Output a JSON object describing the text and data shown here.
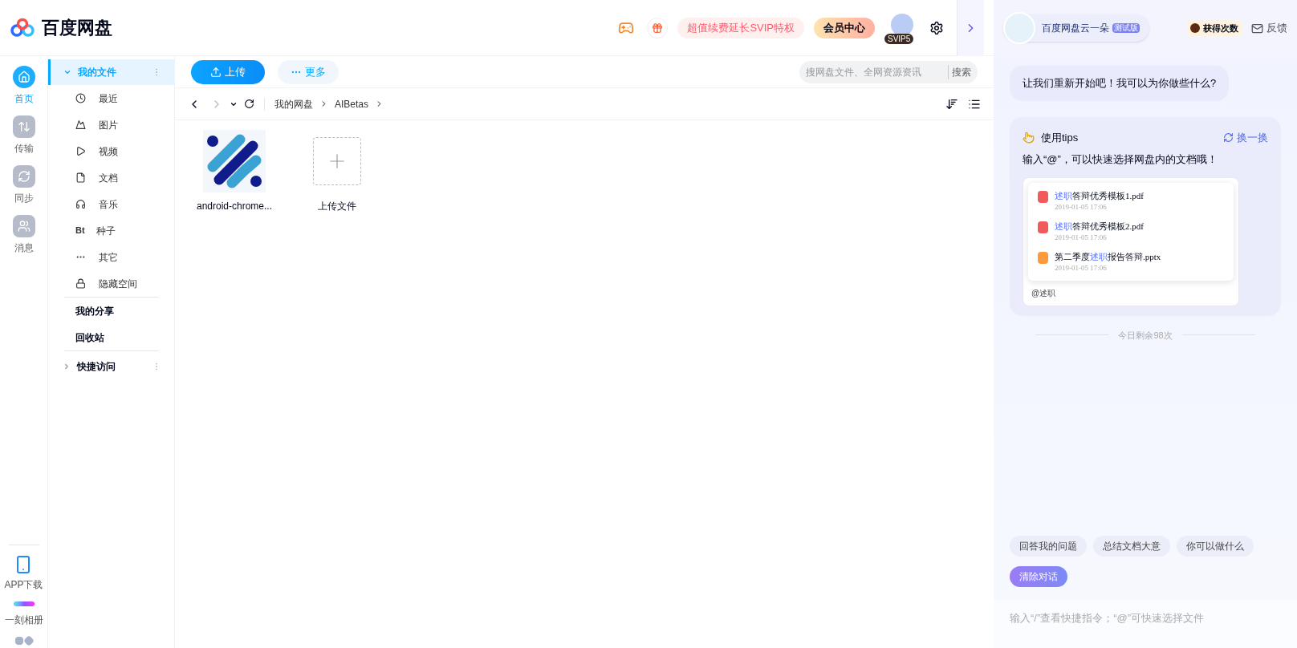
{
  "header": {
    "logo": "百度网盘",
    "promo": "超值续费延长SVIP特权",
    "member_center": "会员中心",
    "vip_badge": "SVIP5"
  },
  "rail": {
    "items": [
      {
        "label": "首页",
        "selected": true
      },
      {
        "label": "传输",
        "selected": false
      },
      {
        "label": "同步",
        "selected": false
      },
      {
        "label": "消息",
        "selected": false
      }
    ],
    "bottom": [
      {
        "label": "APP下载"
      },
      {
        "label": "一刻相册"
      }
    ]
  },
  "sidebar": {
    "root": {
      "label": "我的文件",
      "selected": true,
      "expanded": true
    },
    "items": [
      {
        "label": "最近"
      },
      {
        "label": "图片"
      },
      {
        "label": "视频"
      },
      {
        "label": "文档"
      },
      {
        "label": "音乐"
      },
      {
        "label": "种子",
        "icon_text": "Bt"
      },
      {
        "label": "其它"
      },
      {
        "label": "隐藏空间"
      }
    ],
    "sections": [
      {
        "label": "我的分享"
      },
      {
        "label": "回收站"
      }
    ],
    "quick": {
      "label": "快捷访问",
      "expanded": false
    }
  },
  "toolbar": {
    "upload": "上传",
    "more": "更多",
    "search_placeholder": "搜网盘文件、全网资源资讯",
    "search_button": "搜索"
  },
  "breadcrumb": [
    "我的网盘",
    "AIBetas"
  ],
  "files": [
    {
      "kind": "image",
      "name": "android-chrome..."
    },
    {
      "kind": "upload",
      "name": "上传文件"
    }
  ],
  "assistant": {
    "name": "百度网盘云一朵",
    "tag": "测试版",
    "earn": "获得次数",
    "feedback": "反馈",
    "greeting": "让我们重新开始吧！我可以为你做些什么?",
    "tips": {
      "title": "使用tips",
      "refresh": "换一换",
      "text": "输入“@”，可以快速选择网盘内的文档哦！",
      "docs": [
        {
          "kind": "pdf",
          "highlight": "述职",
          "after": "答辩优秀模板1.pdf",
          "date": "2019-01-05 17:06"
        },
        {
          "kind": "pdf",
          "highlight": "述职",
          "after": "答辩优秀模板2.pdf",
          "date": "2019-01-05 17:06"
        },
        {
          "kind": "ppt",
          "before": "第二季度",
          "highlight": "述职",
          "after": "报告答辩.pptx",
          "date": "2019-01-05 17:06"
        }
      ],
      "input": "@述职"
    },
    "remaining": "今日剩余98次",
    "suggestions": [
      "回答我的问题",
      "总结文档大意",
      "你可以做什么"
    ],
    "clear": "清除对话",
    "input_placeholder": "输入“/”查看快捷指令；“@”可快速选择文件"
  }
}
